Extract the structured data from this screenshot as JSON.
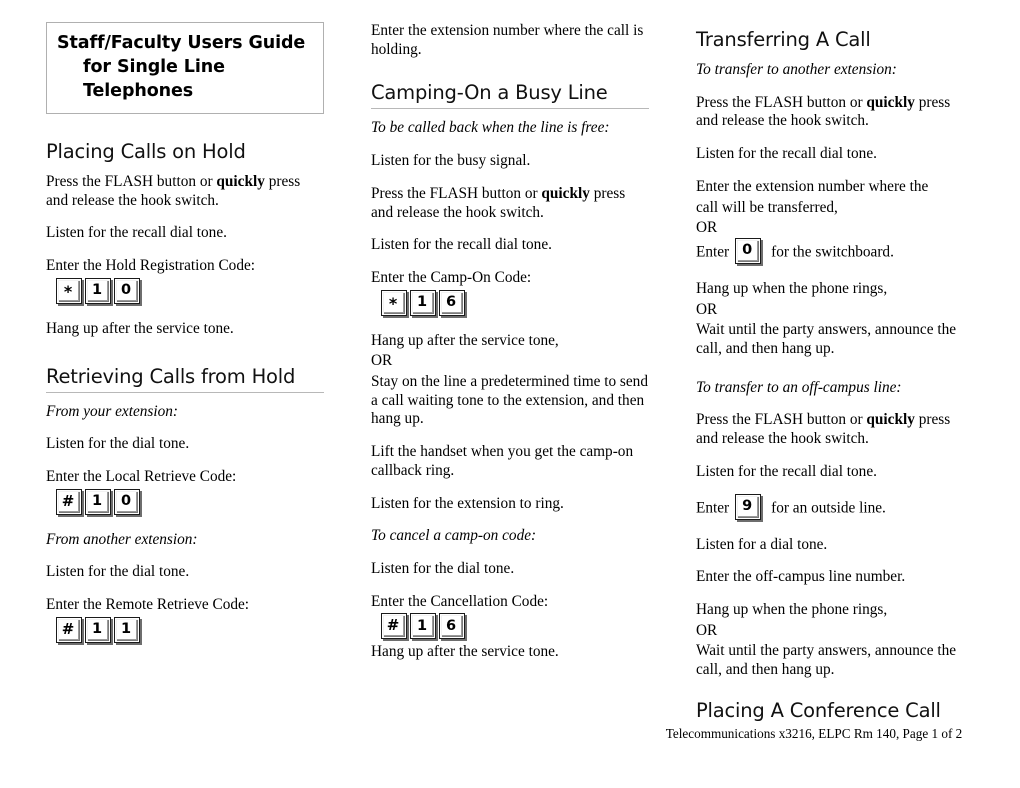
{
  "document": {
    "title_lines": [
      "Staff/Faculty Users Guide",
      "for Single Line",
      "Telephones"
    ]
  },
  "columns": {
    "left": {
      "sections": [
        {
          "heading": "Placing Calls on Hold",
          "ruled": false,
          "steps": [
            "Press the FLASH button or quickly press and release the hook switch.",
            "Listen for the recall dial tone.",
            "Enter the Hold Registration Code:",
            "Hang up after the service tone."
          ],
          "code_label": "Enter the Hold Registration Code:",
          "code_keys": [
            "*",
            "1",
            "0"
          ],
          "press_flash_plain": "Press the FLASH button or ",
          "press_flash_bold": "quickly",
          "press_flash_rest": "press and release the hook switch.",
          "recall_tone": "Listen for the recall dial tone.",
          "hang_up": "Hang up after the service tone."
        },
        {
          "heading": "Retrieving Calls from Hold",
          "ruled": true,
          "sub_a": "From your extension:",
          "sub_a_step1": "Listen for the dial tone.",
          "sub_a_code_label": "Enter the Local Retrieve Code:",
          "sub_a_keys": [
            "#",
            "1",
            "0"
          ],
          "sub_b": "From another extension:",
          "sub_b_step1": "Listen for the dial tone.",
          "sub_b_code_label": "Enter the Remote Retrieve Code:",
          "sub_b_keys": [
            "#",
            "1",
            "1"
          ]
        }
      ]
    },
    "middle": {
      "lead_in": "Enter the extension number where the call is holding.",
      "sections": [
        {
          "heading": "Camping-On a Busy Line",
          "ruled": true,
          "sub_a": "To be called back when the line is free:",
          "step_busy": "Listen for the busy signal.",
          "press_flash_plain": "Press the FLASH button or ",
          "press_flash_bold": "quickly",
          "press_flash_rest": "press and release the hook switch.",
          "recall_tone": "Listen for the recall dial tone.",
          "code_label": "Enter the Camp-On Code:",
          "code_keys": [
            "*",
            "1",
            "6"
          ],
          "hang_up_block": [
            "Hang up after the service tone,",
            "OR",
            "Stay on the line a predetermined time to send a call waiting tone to the extension, and then hang up."
          ],
          "lift_handset": "Lift the handset when you get the camp-on callback ring.",
          "listen_ring": "Listen for the extension to ring.",
          "sub_b": "To cancel a camp-on code:",
          "cancel_step1": "Listen for the dial tone.",
          "cancel_code_label": "Enter the Cancellation Code:",
          "cancel_keys": [
            "#",
            "1",
            "6"
          ],
          "cancel_hang_up": "Hang up after the service tone."
        }
      ]
    },
    "right": {
      "sections": [
        {
          "heading": "Transferring A Call",
          "ruled": false,
          "sub_a": "To transfer to another extension:",
          "press_flash_plain": "Press the FLASH button or ",
          "press_flash_bold": "quickly",
          "press_flash_rest": "press and release the hook switch.",
          "recall_tone": "Listen for the recall dial tone.",
          "ext_block_line1": "Enter the extension number where the",
          "ext_block_line2": "call will be transferred,",
          "ext_block_line3": "OR",
          "enter_label": "Enter",
          "switchboard_key": "0",
          "switchboard_rest": "for the switchboard.",
          "hang_block": [
            "Hang up when the phone rings,",
            "OR",
            "Wait until the party answers, announce the call, and then hang up."
          ],
          "sub_b": "To transfer to an off-campus line:",
          "press_flash2_plain": "Press the FLASH button or ",
          "press_flash2_bold": "quickly",
          "press_flash2_rest": "press and release the hook switch.",
          "recall_tone2": "Listen for the recall dial tone.",
          "enter_label2": "Enter",
          "outside_key": "9",
          "outside_rest": "for an outside line.",
          "dial_tone2": "Listen for a dial tone.",
          "offcampus_number": "Enter the off-campus line number.",
          "hang_block2": [
            "Hang up when the phone rings,",
            "OR",
            "Wait until the party answers, announce the call, and then hang up."
          ]
        }
      ]
    }
  },
  "footer": {
    "heading": "Placing A Conference Call",
    "note": "Telecommunications  x3216, ELPC Rm 140,  Page 1 of 2"
  }
}
